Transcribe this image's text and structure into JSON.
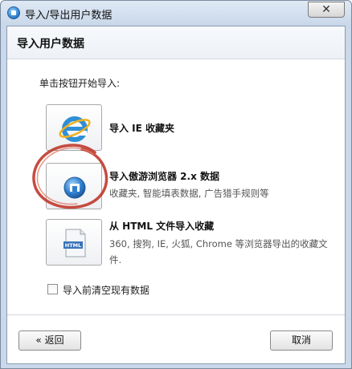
{
  "window": {
    "title": "导入/导出用户数据",
    "close_glyph": "✕"
  },
  "header": {
    "title": "导入用户数据"
  },
  "instruction": "单击按钮开始导入:",
  "options": [
    {
      "title": "导入 IE 收藏夹",
      "description": "",
      "icon": "ie-icon"
    },
    {
      "title": "导入傲游浏览器 2.x 数据",
      "description": "收藏夹, 智能填表数据, 广告猎手规则等",
      "icon": "maxthon-icon"
    },
    {
      "title": "从 HTML 文件导入收藏",
      "description": "360, 搜狗, IE, 火狐, Chrome 等浏览器导出的收藏文件.",
      "icon": "html-file-icon"
    }
  ],
  "checkbox": {
    "label": "导入前清空现有数据",
    "checked": false
  },
  "footer": {
    "back_label": "« 返回",
    "cancel_label": "取消"
  },
  "colors": {
    "annotation_red": "#c0392b",
    "ie_blue": "#2f8fd6"
  }
}
